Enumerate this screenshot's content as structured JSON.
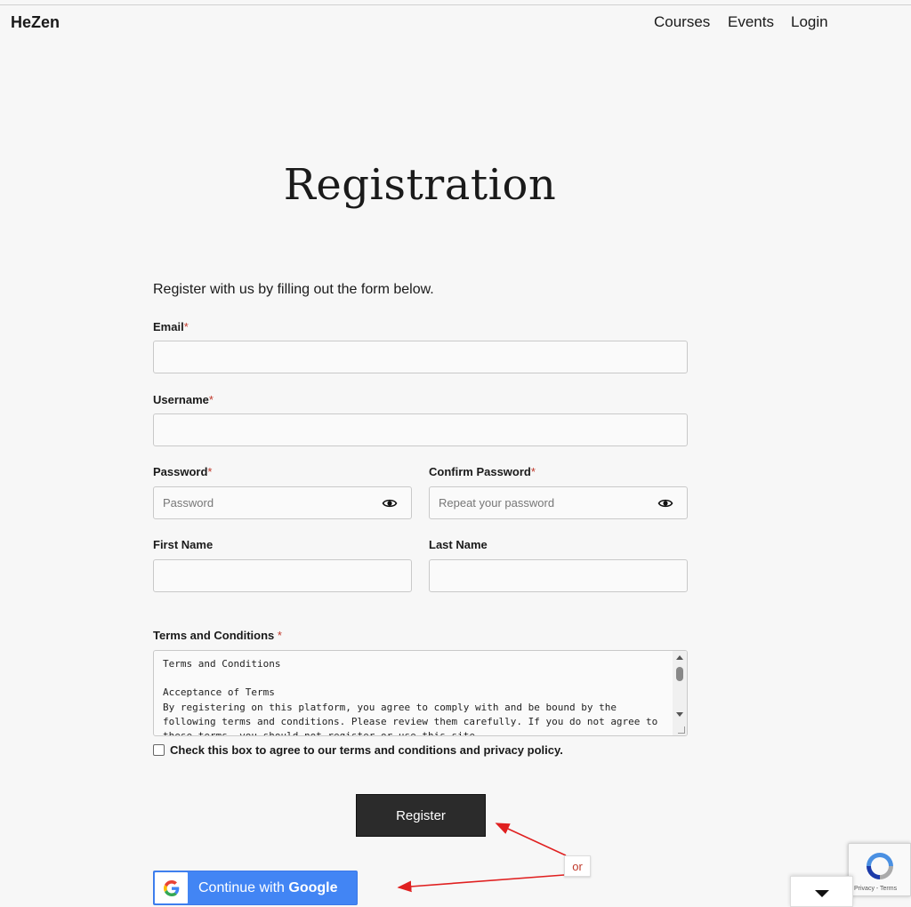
{
  "header": {
    "brand": "HeZen",
    "nav": [
      {
        "label": "Courses"
      },
      {
        "label": "Events"
      },
      {
        "label": "Login"
      }
    ]
  },
  "page": {
    "title": "Registration",
    "intro": "Register with us by filling out the form below."
  },
  "form": {
    "required_mark": "*",
    "email": {
      "label": "Email",
      "value": "",
      "placeholder": ""
    },
    "username": {
      "label": "Username",
      "value": "",
      "placeholder": ""
    },
    "password": {
      "label": "Password",
      "value": "",
      "placeholder": "Password"
    },
    "confirm_password": {
      "label": "Confirm Password",
      "value": "",
      "placeholder": "Repeat your password"
    },
    "first_name": {
      "label": "First Name",
      "value": "",
      "placeholder": ""
    },
    "last_name": {
      "label": "Last Name",
      "value": "",
      "placeholder": ""
    },
    "terms": {
      "label": "Terms and Conditions",
      "text": "Terms and Conditions\n\nAcceptance of Terms\nBy registering on this platform, you agree to comply with and be bound by the following terms and conditions. Please review them carefully. If you do not agree to these terms, you should not register or use this site."
    },
    "agree_checkbox": {
      "label": "Check this box to agree to our terms and conditions and privacy policy.",
      "checked": false
    },
    "register_button": "Register",
    "google_button": {
      "prefix": "Continue with ",
      "brand": "Google"
    }
  },
  "recaptcha": {
    "text": "Privacy - Terms"
  },
  "annotation": {
    "label": "or",
    "color": "#e02020"
  },
  "colors": {
    "background": "#f7f7f7",
    "register_button": "#2b2b2b",
    "google_button": "#4285f4",
    "required_mark": "#c0392b"
  }
}
